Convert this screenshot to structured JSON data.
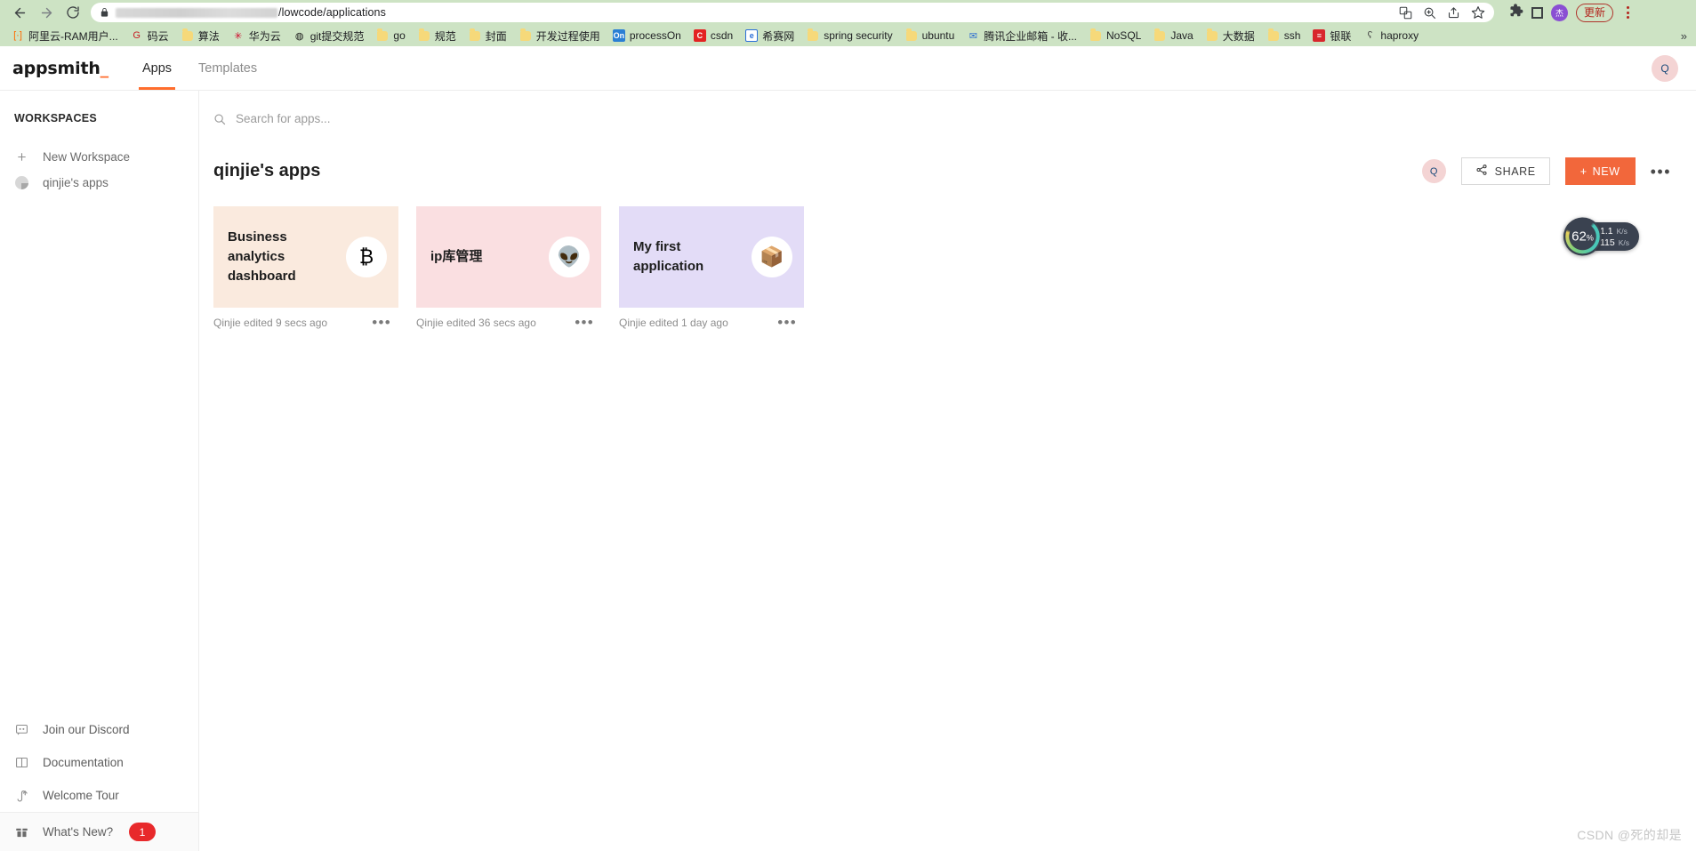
{
  "browser": {
    "back_label": "Back",
    "forward_label": "Forward",
    "reload_label": "Reload",
    "url_visible_suffix": "/lowcode/applications",
    "url_redacted": true,
    "omnibox_icons": [
      "translate-icon",
      "zoom-icon",
      "share-icon",
      "bookmark-star-icon"
    ],
    "extensions_label": "Extensions",
    "sidepanel_label": "Side panel",
    "profile_initial": "杰",
    "update_label": "更新",
    "menu_label": "Customize and control",
    "bookmarks": [
      {
        "label": "阿里云-RAM用户...",
        "icon": "aliyun-icon",
        "type": "brand",
        "color": "#ff6a00",
        "glyph": "[·]"
      },
      {
        "label": "码云",
        "icon": "gitee-icon",
        "type": "brand",
        "color": "#c71d23",
        "glyph": "G"
      },
      {
        "label": "算法",
        "icon": "folder-icon",
        "type": "folder"
      },
      {
        "label": "华为云",
        "icon": "huawei-icon",
        "type": "brand",
        "color": "#cf0a2c",
        "glyph": "✳"
      },
      {
        "label": "git提交规范",
        "icon": "globe-icon",
        "type": "brand",
        "color": "#1a1a1a",
        "glyph": "◍"
      },
      {
        "label": "go",
        "icon": "folder-icon",
        "type": "folder"
      },
      {
        "label": "规范",
        "icon": "folder-icon",
        "type": "folder"
      },
      {
        "label": "封面",
        "icon": "folder-icon",
        "type": "folder"
      },
      {
        "label": "开发过程使用",
        "icon": "folder-icon",
        "type": "folder"
      },
      {
        "label": "processOn",
        "icon": "processon-icon",
        "type": "square",
        "color": "#2a7fd4",
        "glyph": "On"
      },
      {
        "label": "csdn",
        "icon": "csdn-icon",
        "type": "square",
        "color": "#e32222",
        "glyph": "C"
      },
      {
        "label": "希赛网",
        "icon": "edge-icon",
        "type": "square",
        "color": "#ffffff",
        "glyph": "e"
      },
      {
        "label": "spring security",
        "icon": "folder-icon",
        "type": "folder"
      },
      {
        "label": "ubuntu",
        "icon": "folder-icon",
        "type": "folder"
      },
      {
        "label": "腾讯企业邮箱 - 收...",
        "icon": "tencent-mail-icon",
        "type": "brand",
        "color": "#2f6fd0",
        "glyph": "✉"
      },
      {
        "label": "NoSQL",
        "icon": "folder-icon",
        "type": "folder"
      },
      {
        "label": "Java",
        "icon": "folder-icon",
        "type": "folder"
      },
      {
        "label": "大数据",
        "icon": "folder-icon",
        "type": "folder"
      },
      {
        "label": "ssh",
        "icon": "folder-icon",
        "type": "folder"
      },
      {
        "label": "银联",
        "icon": "unionpay-icon",
        "type": "square",
        "color": "#d8262c",
        "glyph": "≡"
      },
      {
        "label": "haproxy",
        "icon": "haproxy-icon",
        "type": "brand",
        "color": "#444444",
        "glyph": "ʕ"
      }
    ],
    "bookmarks_overflow": "»"
  },
  "header": {
    "logo_text": "appsmith",
    "logo_cursor": "_",
    "tabs": [
      {
        "label": "Apps",
        "active": true
      },
      {
        "label": "Templates",
        "active": false
      }
    ],
    "avatar_initial": "Q"
  },
  "sidebar": {
    "section_title": "WORKSPACES",
    "new_workspace_label": "New Workspace",
    "workspaces": [
      {
        "label": "qinjie's apps"
      }
    ],
    "bottom_items": [
      {
        "label": "Join our Discord",
        "icon": "discord-icon",
        "badge": null
      },
      {
        "label": "Documentation",
        "icon": "book-icon",
        "badge": null
      },
      {
        "label": "Welcome Tour",
        "icon": "tour-icon",
        "badge": null
      },
      {
        "label": "What's New?",
        "icon": "gift-icon",
        "badge": "1"
      }
    ]
  },
  "search": {
    "placeholder": "Search for apps...",
    "value": ""
  },
  "workspace": {
    "name": "qinjie's apps",
    "member_avatar": "Q",
    "share_label": "SHARE",
    "new_label": "NEW",
    "new_prefix": "+",
    "more_label": "•••"
  },
  "apps": [
    {
      "title": "Business analytics dashboard",
      "meta": "Qinjie edited 9 secs ago",
      "bg": "#faeade",
      "icon": "bitcoin-icon",
      "glyph": "₿",
      "menu": "•••"
    },
    {
      "title": "ip库管理",
      "meta": "Qinjie edited 36 secs ago",
      "bg": "#fadfe1",
      "icon": "alien-icon",
      "glyph": "👽",
      "menu": "•••"
    },
    {
      "title": "My first application",
      "meta": "Qinjie edited 1 day ago",
      "bg": "#e3dcf7",
      "icon": "box-icon",
      "glyph": "📦",
      "menu": "•••"
    }
  ],
  "network_widget": {
    "cpu_percent": "62",
    "percent_symbol": "%",
    "upload_value": "1.1",
    "upload_unit": "K/s",
    "upload_arrow": "↑",
    "download_value": "115",
    "download_unit": "K/s",
    "download_arrow": "↓"
  },
  "watermark": "CSDN @死的却是",
  "colors": {
    "accent_orange": "#ff6d2d",
    "new_button": "#f2673b",
    "chrome_bg": "#cde3c4",
    "badge_red": "#e8292b"
  }
}
